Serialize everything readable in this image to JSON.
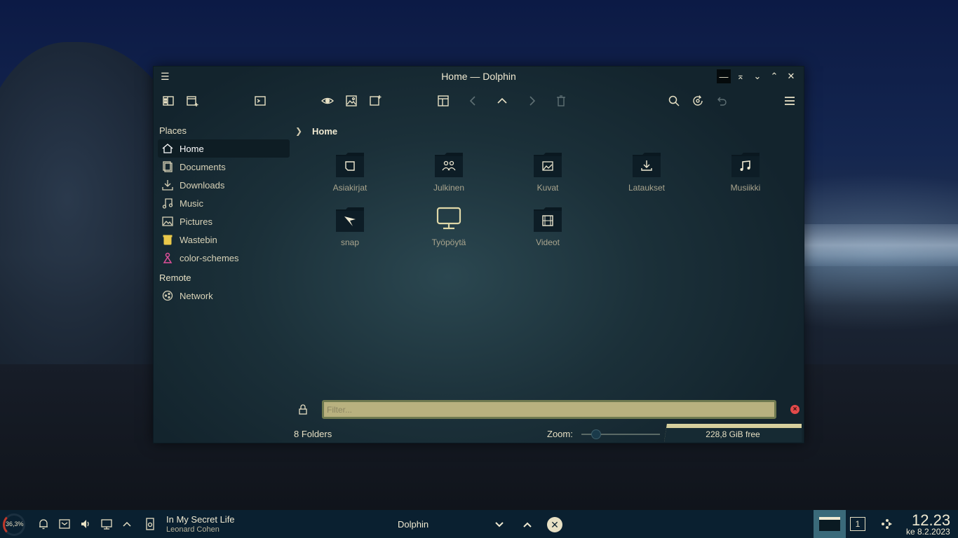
{
  "window": {
    "title": "Home — Dolphin",
    "controls": {
      "minimize": "—",
      "keep_above": "⌅",
      "shade": "⌄",
      "maximize": "⌃",
      "close": "✕"
    }
  },
  "sidebar": {
    "places_title": "Places",
    "places": [
      {
        "label": "Home",
        "icon": "home-icon"
      },
      {
        "label": "Documents",
        "icon": "documents-icon"
      },
      {
        "label": "Downloads",
        "icon": "downloads-icon"
      },
      {
        "label": "Music",
        "icon": "music-icon"
      },
      {
        "label": "Pictures",
        "icon": "pictures-icon"
      },
      {
        "label": "Wastebin",
        "icon": "trash-icon"
      },
      {
        "label": "color-schemes",
        "icon": "color-schemes-icon"
      }
    ],
    "remote_title": "Remote",
    "remote": [
      {
        "label": "Network",
        "icon": "network-icon"
      }
    ]
  },
  "breadcrumb": {
    "current": "Home"
  },
  "folders": [
    {
      "label": "Asiakirjat",
      "icon": "document-folder-icon"
    },
    {
      "label": "Julkinen",
      "icon": "public-folder-icon"
    },
    {
      "label": "Kuvat",
      "icon": "pictures-folder-icon"
    },
    {
      "label": "Lataukset",
      "icon": "downloads-folder-icon"
    },
    {
      "label": "Musiikki",
      "icon": "music-folder-icon"
    },
    {
      "label": "snap",
      "icon": "snap-folder-icon"
    },
    {
      "label": "Työpöytä",
      "icon": "desktop-icon"
    },
    {
      "label": "Videot",
      "icon": "videos-folder-icon"
    }
  ],
  "filter": {
    "placeholder": "Filter..."
  },
  "status": {
    "summary": "8 Folders",
    "zoom_label": "Zoom:",
    "free_space": "228,8 GiB free"
  },
  "taskbar": {
    "cpu": "36,3%",
    "media_title": "In My Secret Life",
    "media_artist": "Leonard Cohen",
    "task_name": "Dolphin",
    "pager": "1",
    "time": "12.23",
    "date": "ke 8.2.2023"
  },
  "colors": {
    "accent": "#b8b17f",
    "text": "#e7e0c4",
    "window_bg": "#1b3039",
    "taskbar_bg": "#0a2030"
  }
}
